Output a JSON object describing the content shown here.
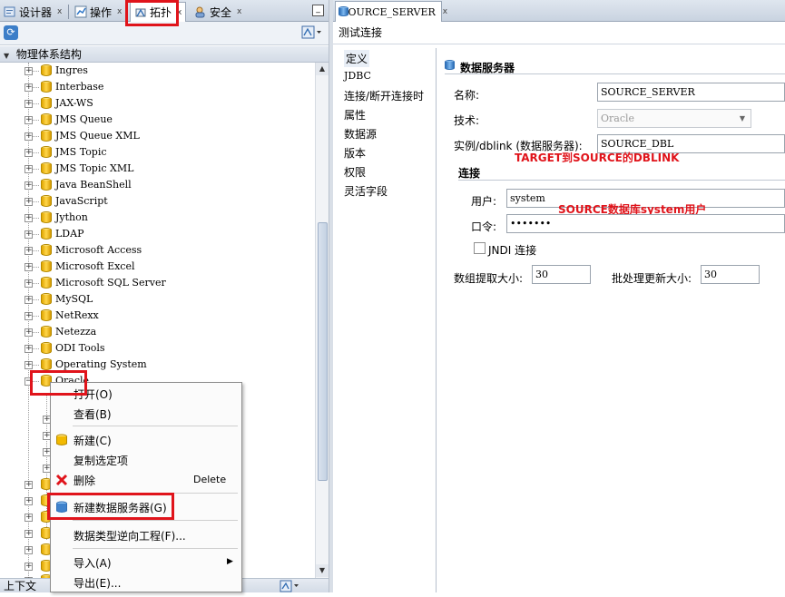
{
  "left_tabs": [
    {
      "label": "设计器",
      "icon": "designer-icon"
    },
    {
      "label": "操作",
      "icon": "operations-icon"
    },
    {
      "label": "拓扑",
      "icon": "topology-icon"
    },
    {
      "label": "安全",
      "icon": "security-icon"
    }
  ],
  "left_close_glyph": "x",
  "minimize_glyph": "_",
  "accordion_title": "物理体系结构",
  "tree_items": [
    "Ingres",
    "Interbase",
    "JAX-WS",
    "JMS Queue",
    "JMS Queue XML",
    "JMS Topic",
    "JMS Topic XML",
    "Java BeanShell",
    "JavaScript",
    "Jython",
    "LDAP",
    "Microsoft Access",
    "Microsoft Excel",
    "Microsoft SQL Server",
    "MySQL",
    "NetRexx",
    "Netezza",
    "ODI Tools",
    "Operating System",
    "Oracle"
  ],
  "bottom_accordion_title": "上下文",
  "context_menu": {
    "open": "打开(O)",
    "view": "查看(B)",
    "new": "新建(C)",
    "duplicate": "复制选定项",
    "delete": "删除",
    "delete_shortcut": "Delete",
    "new_data_server": "新建数据服务器(G)",
    "reverse_engineer": "数据类型逆向工程(F)...",
    "import": "导入(A)",
    "export": "导出(E)..."
  },
  "editor_tab": {
    "label": "SOURCE_SERVER",
    "close": "x"
  },
  "test_connection": "测试连接",
  "nav_items": [
    "定义",
    "JDBC",
    "连接/断开连接时",
    "属性",
    "数据源",
    "版本",
    "权限",
    "灵活字段"
  ],
  "section_title": "数据服务器",
  "form": {
    "name_label": "名称:",
    "name_value": "SOURCE_SERVER",
    "tech_label": "技术:",
    "tech_value": "Oracle",
    "instance_label": "实例/dblink (数据服务器):",
    "instance_value": "SOURCE_DBL",
    "connection_title": "连接",
    "user_label": "用户:",
    "user_value": "system",
    "password_label": "口令:",
    "password_value": "•••••••",
    "jndi_label": "JNDI 连接",
    "array_fetch_label": "数组提取大小:",
    "array_fetch_value": "30",
    "batch_update_label": "批处理更新大小:",
    "batch_update_value": "30"
  },
  "annotations": {
    "dblink": "TARGET到SOURCE的DBLINK",
    "user": "SOURCE数据库system用户"
  },
  "colors": {
    "highlight": "#e0141b",
    "annotation": "#e0141b",
    "folder_icon": "#f2b900",
    "server_icon": "#2f6fb5"
  }
}
